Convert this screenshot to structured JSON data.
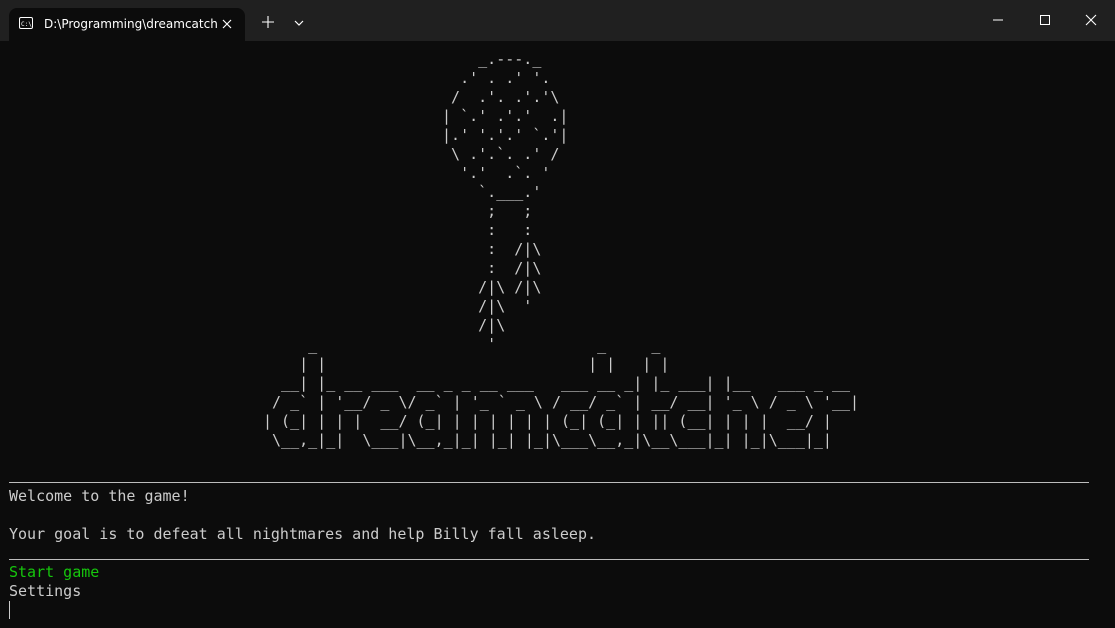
{
  "window": {
    "tab_title": "D:\\Programming\\dreamcatch",
    "tab_icon": "terminal-icon",
    "new_tab_icon": "plus-icon",
    "dropdown_icon": "chevron-down-icon",
    "minimize_icon": "minimize-icon",
    "maximize_icon": "maximize-icon",
    "close_icon": "close-icon"
  },
  "terminal": {
    "balloon_art": "     _.---._\n   .' . .' '.\n  /  .'. .'.'\\\n | `.' .'.'  .|\n |.' '.'.' `.'|\n  \\ .'.`. .' /\n   '.'  .`. '\n     `.___.'\n      ;   ;\n      :   :\n      :  /|\\\n      :  /|\\\n     /|\\ /|\\\n     /|\\  '\n     /|\\\n      '",
    "logo_art": "     _                               _     _\n    | |                             | |   | |\n  __| |_ __ ___  __ _ _ __ ___   ___ __ _| |_ ___| |__   ___ _ __\n / _` | '__/ _ \\/ _` | '_ ` _ \\ / __/ _` | __/ __| '_ \\ / _ \\ '__|\n| (_| | | |  __/ (_| | | | | | | (_| (_| | || (__| | | |  __/ |\n \\__,_|_|  \\___|\\__,_|_| |_| |_|\\___\\__,_|\\__\\___|_| |_|\\___|_|",
    "welcome": "Welcome to the game!",
    "goal": "Your goal is to defeat all nightmares and help Billy fall asleep.",
    "menu": {
      "start": "Start game",
      "settings": "Settings"
    },
    "highlight_color": "#16c60c",
    "text_color": "#cccccc",
    "background_color": "#0c0c0c"
  }
}
